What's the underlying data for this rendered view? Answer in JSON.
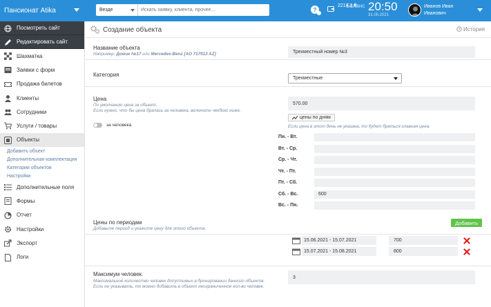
{
  "topbar": {
    "brand": "Пансионат Atika",
    "search_scope": "Везде",
    "search_placeholder": "Искать заявку, клиента, прочее...",
    "balance_label": "Баланс",
    "balance_value": "2214.3 ₴",
    "time": "20:50",
    "date": "31.05.2021",
    "user_name": "Иванов Иван Иванович"
  },
  "sidebar": {
    "view_site": "Посмотреть сайт",
    "edit_site": "Редактировать сайт",
    "items": [
      {
        "label": "Шахматка",
        "icon": "chess-grid-icon"
      },
      {
        "label": "Заявки с форм",
        "icon": "inbox-icon"
      },
      {
        "label": "Продажа билетов",
        "icon": "ticket-icon"
      },
      {
        "label": "Клиенты",
        "icon": "user-icon"
      },
      {
        "label": "Сотрудники",
        "icon": "team-icon"
      },
      {
        "label": "Услуги / товары",
        "icon": "cart-icon"
      },
      {
        "label": "Объекты",
        "icon": "objects-icon"
      }
    ],
    "sub_items": [
      "Добавить объект",
      "Дополнительная комплектация",
      "Категории объектов",
      "Настройки"
    ],
    "items_after": [
      {
        "label": "Дополнительные поля",
        "icon": "list-icon"
      },
      {
        "label": "Формы",
        "icon": "form-icon"
      },
      {
        "label": "Отчет",
        "icon": "chart-icon"
      },
      {
        "label": "Настройки",
        "icon": "gear-icon"
      },
      {
        "label": "Экспорт",
        "icon": "export-icon"
      },
      {
        "label": "Логи",
        "icon": "log-icon"
      }
    ]
  },
  "main": {
    "title": "Создание объекта",
    "history": "История",
    "name_label": "Название объекта",
    "name_hint_prefix": "Например:",
    "name_hint_ex1": "Домик №17",
    "name_hint_or": "или",
    "name_hint_ex2": "Mercedes-Benz [AO 717513 AZ]",
    "name_value": "Трехместный номер №3",
    "category_label": "Категория",
    "category_value": "Трехместные",
    "price_label": "Цена",
    "price_hint": "По умолчанию цена за объект.\nЕсли нужно, что бы цена бралась за человека, включите чекбокс ниже.",
    "per_person_label": "за человека",
    "price_value": "570.00",
    "day_prices_button": "цены по дням",
    "day_prices_hint": "Если цена в этот день не указана, то будет браться главная цена.",
    "day_rows": [
      {
        "label": "Пн. - Вт.",
        "value": ""
      },
      {
        "label": "Вт. - Ср.",
        "value": ""
      },
      {
        "label": "Ср. - Чт.",
        "value": ""
      },
      {
        "label": "Чт. - Пт.",
        "value": ""
      },
      {
        "label": "Пт. - Сб.",
        "value": ""
      },
      {
        "label": "Сб. - Вс.",
        "value": "600"
      },
      {
        "label": "Вс. - Пн.",
        "value": ""
      }
    ],
    "periods_label": "Цены по периодам",
    "periods_hint": "Добавьте период и укажите цену для этого объекта.",
    "add_button": "Добавить",
    "periods": [
      {
        "range": "15.06.2021 - 15.07.2021",
        "price": "700"
      },
      {
        "range": "15.07.2021 - 15.08.2021",
        "price": "800"
      }
    ],
    "max_people_label": "Максимум человек.",
    "max_people_hint": "Максимальное количество человек допустимых в бронировании данного объекта.\nЕсли не указывать, то можно добавить в объект неограниченное кол-во человек.",
    "max_people_value": "3"
  },
  "colors": {
    "topbar": "#2a8fd8",
    "sidebar_dark": "#3a3f45",
    "add_button": "#5fc44a",
    "delete": "#e02020"
  }
}
